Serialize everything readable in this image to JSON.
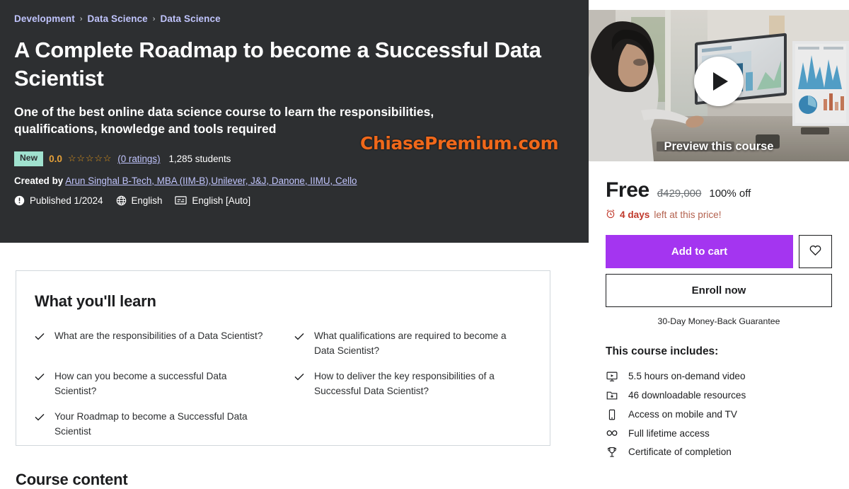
{
  "breadcrumb": {
    "items": [
      "Development",
      "Data Science",
      "Data Science"
    ],
    "separator": "›"
  },
  "hero": {
    "title": "A Complete Roadmap to become a Successful Data Scientist",
    "subtitle": "One of the best online data science course to learn the responsibilities, qualifications, knowledge and tools required",
    "badge_new": "New",
    "rating_value": "0.0",
    "stars": "☆☆☆☆☆",
    "ratings_link": "(0 ratings)",
    "students": "1,285 students",
    "created_by_label": "Created by",
    "instructor": "Arun Singhal B-Tech, MBA (IIM-B),Unilever, J&J, Danone, IIMU, Cello",
    "published": "Published 1/2024",
    "language": "English",
    "captions": "English [Auto]",
    "background_color": "#2d2f31",
    "link_color": "#c0c4fc",
    "badge_color": "#a0e2cf",
    "star_color": "#e59819"
  },
  "watermark": {
    "text": "ChiasePremium.com",
    "color": "#f0681a"
  },
  "preview": {
    "label": "Preview this course",
    "play_icon": "play-icon"
  },
  "purchase": {
    "price_now": "Free",
    "price_was": "đ429,000",
    "discount": "100% off",
    "deadline_bold": "4 days",
    "deadline_rest": "left at this price!",
    "deadline_icon": "alarm-clock-icon",
    "add_to_cart": "Add to cart",
    "wishlist_icon": "heart-icon",
    "enroll_now": "Enroll now",
    "guarantee": "30-Day Money-Back Guarantee",
    "accent_color": "#a435f0",
    "deadline_color": "#c0392b"
  },
  "includes": {
    "title": "This course includes:",
    "items": [
      {
        "icon": "monitor-play-icon",
        "label": "5.5 hours on-demand video"
      },
      {
        "icon": "file-download-icon",
        "label": "46 downloadable resources"
      },
      {
        "icon": "mobile-icon",
        "label": "Access on mobile and TV"
      },
      {
        "icon": "infinity-icon",
        "label": "Full lifetime access"
      },
      {
        "icon": "trophy-icon",
        "label": "Certificate of completion"
      }
    ]
  },
  "learn": {
    "title": "What you'll learn",
    "items": [
      "What are the responsibilities of a Data Scientist?",
      "What qualifications are required to become a Data Scientist?",
      "How can you become a successful Data Scientist?",
      "How to deliver the key responsibilities of a Successful Data Scientist?",
      "Your Roadmap to become a Successful Data Scientist"
    ]
  },
  "course_content": {
    "title": "Course content"
  }
}
